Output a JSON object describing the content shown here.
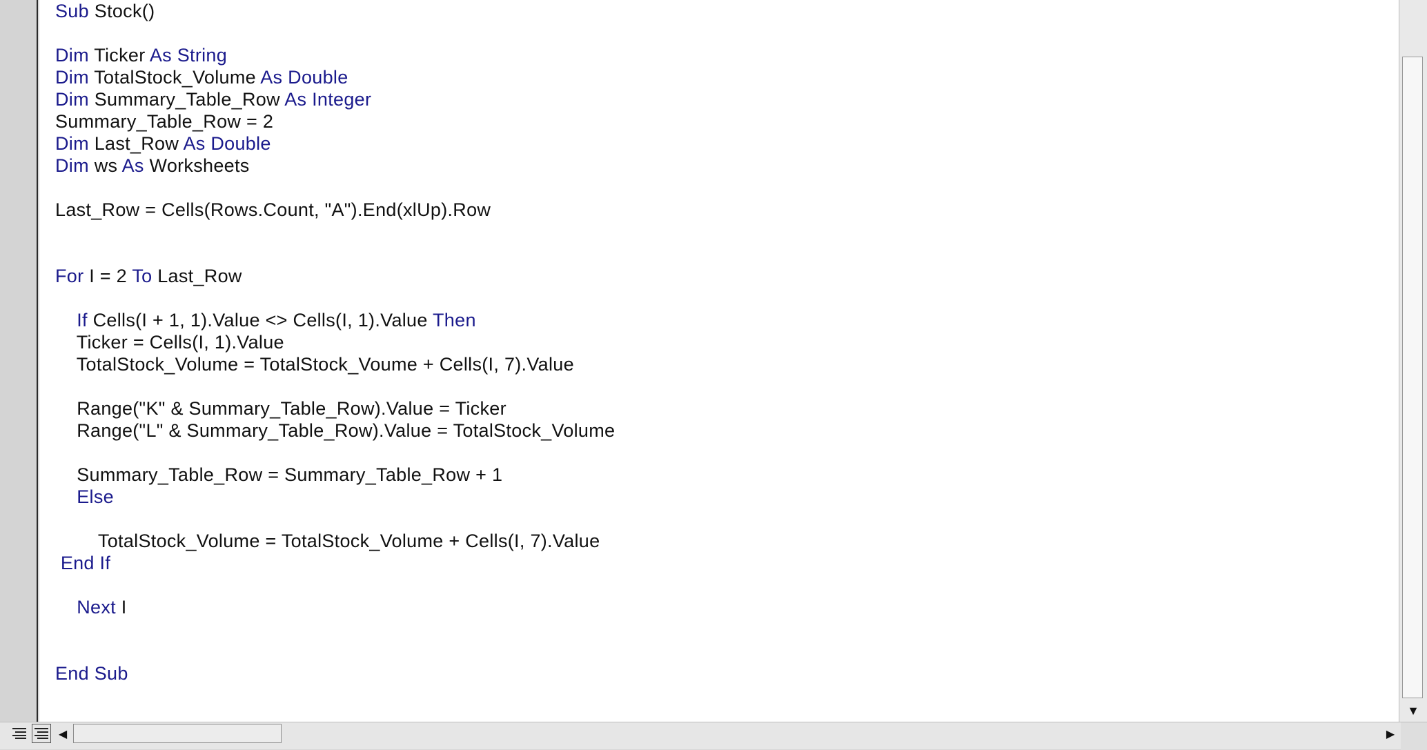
{
  "editor": {
    "lines": [
      [
        {
          "t": "Sub",
          "k": true
        },
        {
          "t": " Stock()",
          "k": false
        }
      ],
      [],
      [
        {
          "t": "Dim",
          "k": true
        },
        {
          "t": " Ticker ",
          "k": false
        },
        {
          "t": "As String",
          "k": true
        }
      ],
      [
        {
          "t": "Dim",
          "k": true
        },
        {
          "t": " TotalStock_Volume ",
          "k": false
        },
        {
          "t": "As Double",
          "k": true
        }
      ],
      [
        {
          "t": "Dim",
          "k": true
        },
        {
          "t": " Summary_Table_Row ",
          "k": false
        },
        {
          "t": "As Integer",
          "k": true
        }
      ],
      [
        {
          "t": "Summary_Table_Row = 2",
          "k": false
        }
      ],
      [
        {
          "t": "Dim",
          "k": true
        },
        {
          "t": " Last_Row ",
          "k": false
        },
        {
          "t": "As Double",
          "k": true
        }
      ],
      [
        {
          "t": "Dim",
          "k": true
        },
        {
          "t": " ws ",
          "k": false
        },
        {
          "t": "As",
          "k": true
        },
        {
          "t": " Worksheets",
          "k": false
        }
      ],
      [],
      [
        {
          "t": "Last_Row = Cells(Rows.Count, \"A\").End(xlUp).Row",
          "k": false
        }
      ],
      [],
      [],
      [
        {
          "t": "For",
          "k": true
        },
        {
          "t": " I = 2 ",
          "k": false
        },
        {
          "t": "To",
          "k": true
        },
        {
          "t": " Last_Row",
          "k": false
        }
      ],
      [],
      [
        {
          "t": "    ",
          "k": false
        },
        {
          "t": "If",
          "k": true
        },
        {
          "t": " Cells(I + 1, 1).Value <> Cells(I, 1).Value ",
          "k": false
        },
        {
          "t": "Then",
          "k": true
        }
      ],
      [
        {
          "t": "    Ticker = Cells(I, 1).Value",
          "k": false
        }
      ],
      [
        {
          "t": "    TotalStock_Volume = TotalStock_Voume + Cells(I, 7).Value",
          "k": false
        }
      ],
      [],
      [
        {
          "t": "    Range(\"K\" & Summary_Table_Row).Value = Ticker",
          "k": false
        }
      ],
      [
        {
          "t": "    Range(\"L\" & Summary_Table_Row).Value = TotalStock_Volume",
          "k": false
        }
      ],
      [],
      [
        {
          "t": "    Summary_Table_Row = Summary_Table_Row + 1",
          "k": false
        }
      ],
      [
        {
          "t": "    ",
          "k": false
        },
        {
          "t": "Else",
          "k": true
        }
      ],
      [],
      [
        {
          "t": "        TotalStock_Volume = TotalStock_Volume + Cells(I, 7).Value",
          "k": false
        }
      ],
      [
        {
          "t": " ",
          "k": false
        },
        {
          "t": "End If",
          "k": true
        }
      ],
      [],
      [
        {
          "t": "    ",
          "k": false
        },
        {
          "t": "Next",
          "k": true
        },
        {
          "t": " I",
          "k": false
        }
      ],
      [],
      [],
      [
        {
          "t": "End Sub",
          "k": true
        }
      ]
    ]
  },
  "colors": {
    "keyword": "#1a1a8c",
    "text": "#111111",
    "editor_bg": "#ffffff",
    "chrome_bg": "#d7d7d7"
  },
  "icons": {
    "procedure_view": "procedure-view-icon",
    "full_module_view": "full-module-view-icon",
    "scroll_left": "◀",
    "scroll_right": "▶",
    "scroll_down": "▼"
  }
}
